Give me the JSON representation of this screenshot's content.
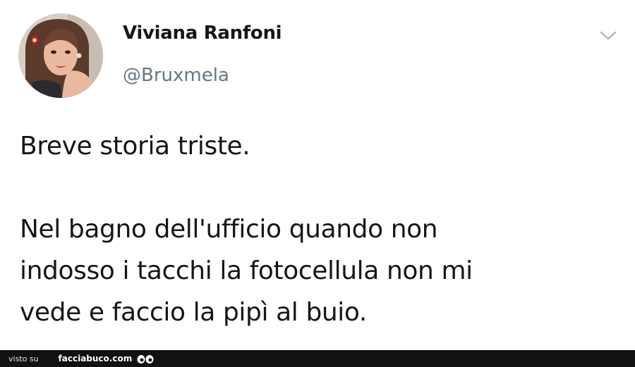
{
  "tweet": {
    "author": {
      "display_name": "Viviana Ranfoni",
      "handle": "@Bruxmela"
    },
    "menu_icon": "chevron-down-icon",
    "text_lines": [
      "Breve storia triste.",
      "",
      "Nel bagno dell'ufficio quando non",
      "indosso i tacchi la fotocellula non mi",
      "vede e faccio la pipì al buio."
    ]
  },
  "footer": {
    "prefix": "visto su",
    "site": "facciabuco.com",
    "logo_icon": "eyes-icon"
  },
  "colors": {
    "text": "#14171a",
    "handle": "#657786",
    "footer_bg": "#111111",
    "caret": "#aab8c2"
  }
}
